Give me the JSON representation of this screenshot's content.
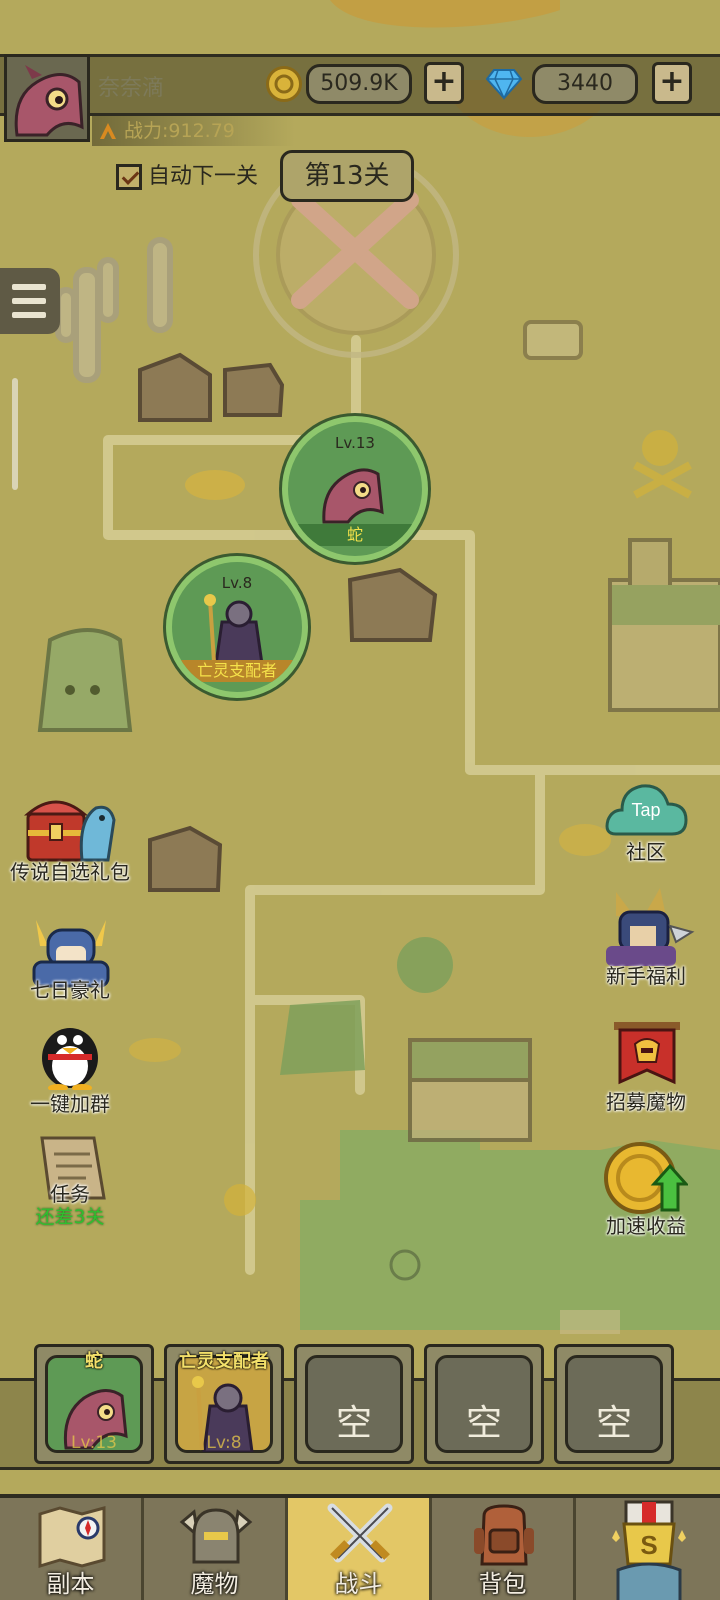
{
  "player": {
    "name": "奈奈滴",
    "power_label": "战力:912.79"
  },
  "currency": {
    "coins": "509.9K",
    "gems": "3440",
    "plus_symbol": "+",
    "coin_icon": "coin-icon",
    "gem_icon": "diamond-icon"
  },
  "stage": {
    "auto_next_label": "自动下一关",
    "auto_next_checked": true,
    "level_label": "第13关"
  },
  "map_units": [
    {
      "level": "Lv.13",
      "name": "蛇",
      "name_color": "#f5e24a"
    },
    {
      "level": "Lv.8",
      "name": "亡灵支配者",
      "name_color": "#f5e24a"
    }
  ],
  "left_buttons": [
    {
      "label": "传说自选礼包",
      "icon": "treasure-chest-icon"
    },
    {
      "label": "七日豪礼",
      "icon": "knight-icon"
    },
    {
      "label": "一键加群",
      "icon": "penguin-icon"
    },
    {
      "label": "任务",
      "sub": "还差3关",
      "icon": "quest-scroll-icon"
    }
  ],
  "right_buttons": [
    {
      "label": "社区",
      "icon": "tap-cloud-icon",
      "icon_text": "Tap"
    },
    {
      "label": "新手福利",
      "icon": "warrior-icon"
    },
    {
      "label": "招募魔物",
      "icon": "recruit-banner-icon"
    },
    {
      "label": "加速收益",
      "icon": "boost-coin-icon"
    }
  ],
  "formation": [
    {
      "name": "蛇",
      "level": "Lv:13",
      "filled": true
    },
    {
      "name": "亡灵支配者",
      "level": "Lv:8",
      "filled": true
    },
    {
      "empty": "空",
      "filled": false
    },
    {
      "empty": "空",
      "filled": false
    },
    {
      "empty": "空",
      "filled": false
    }
  ],
  "nav": [
    {
      "label": "副本",
      "icon": "map-icon",
      "active": false
    },
    {
      "label": "魔物",
      "icon": "helmet-icon",
      "active": false
    },
    {
      "label": "战斗",
      "icon": "crossed-swords-icon",
      "active": true
    },
    {
      "label": "背包",
      "icon": "backpack-icon",
      "active": false
    },
    {
      "label": "",
      "icon": "rank-trophy-icon",
      "active": false
    }
  ]
}
